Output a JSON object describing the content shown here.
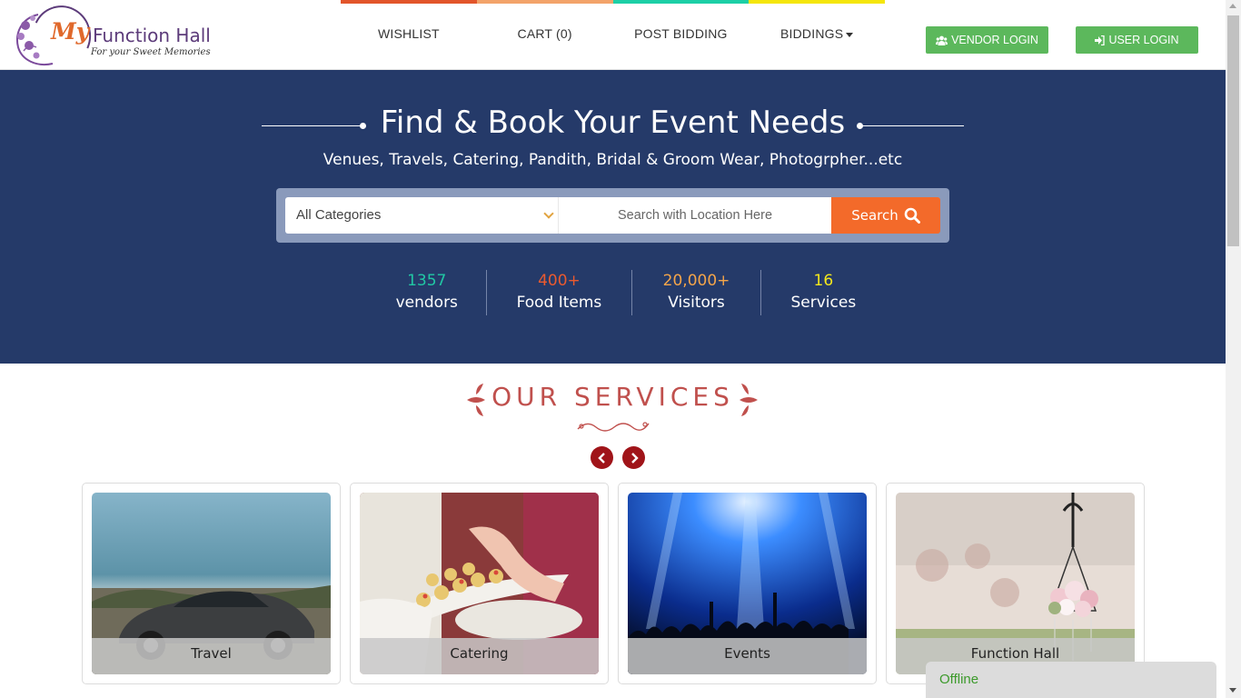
{
  "header": {
    "logo": {
      "brand_my": "My",
      "brand_name": "Function Hall",
      "tagline": "For your Sweet Memories"
    },
    "nav_stripe_colors": [
      "#e2552b",
      "#f3a36a",
      "#1ccfa6",
      "#f5e60b"
    ],
    "nav": [
      {
        "label": "WISHLIST"
      },
      {
        "label": "CART (0)"
      },
      {
        "label": "POST BIDDING"
      },
      {
        "label": "BIDDINGS"
      }
    ],
    "vendor_login": "VENDOR LOGIN",
    "user_login": "USER LOGIN",
    "button_color": "#5cb85c"
  },
  "hero": {
    "background": "#253a69",
    "title": "Find & Book Your Event Needs",
    "subtitle": "Venues, Travels, Catering, Pandith, Bridal & Groom Wear, Photogrpher...etc",
    "search": {
      "category_value": "All Categories",
      "location_placeholder": "Search with Location Here",
      "button_label": "Search",
      "button_color": "#f36a2a"
    },
    "stats": [
      {
        "number": "1357",
        "label": "vendors",
        "color": "#21c7a4"
      },
      {
        "number": "400+",
        "label": "Food Items",
        "color": "#ea5a2f"
      },
      {
        "number": "20,000+",
        "label": "Visitors",
        "color": "#f4a54a"
      },
      {
        "number": "16",
        "label": "Services",
        "color": "#f3e71c"
      }
    ]
  },
  "services": {
    "title": "OUR SERVICES",
    "accent_color": "#c0504d",
    "cards": [
      {
        "label": "Travel"
      },
      {
        "label": "Catering"
      },
      {
        "label": "Events"
      },
      {
        "label": "Function Hall"
      }
    ]
  },
  "chat": {
    "status": "Offline"
  }
}
